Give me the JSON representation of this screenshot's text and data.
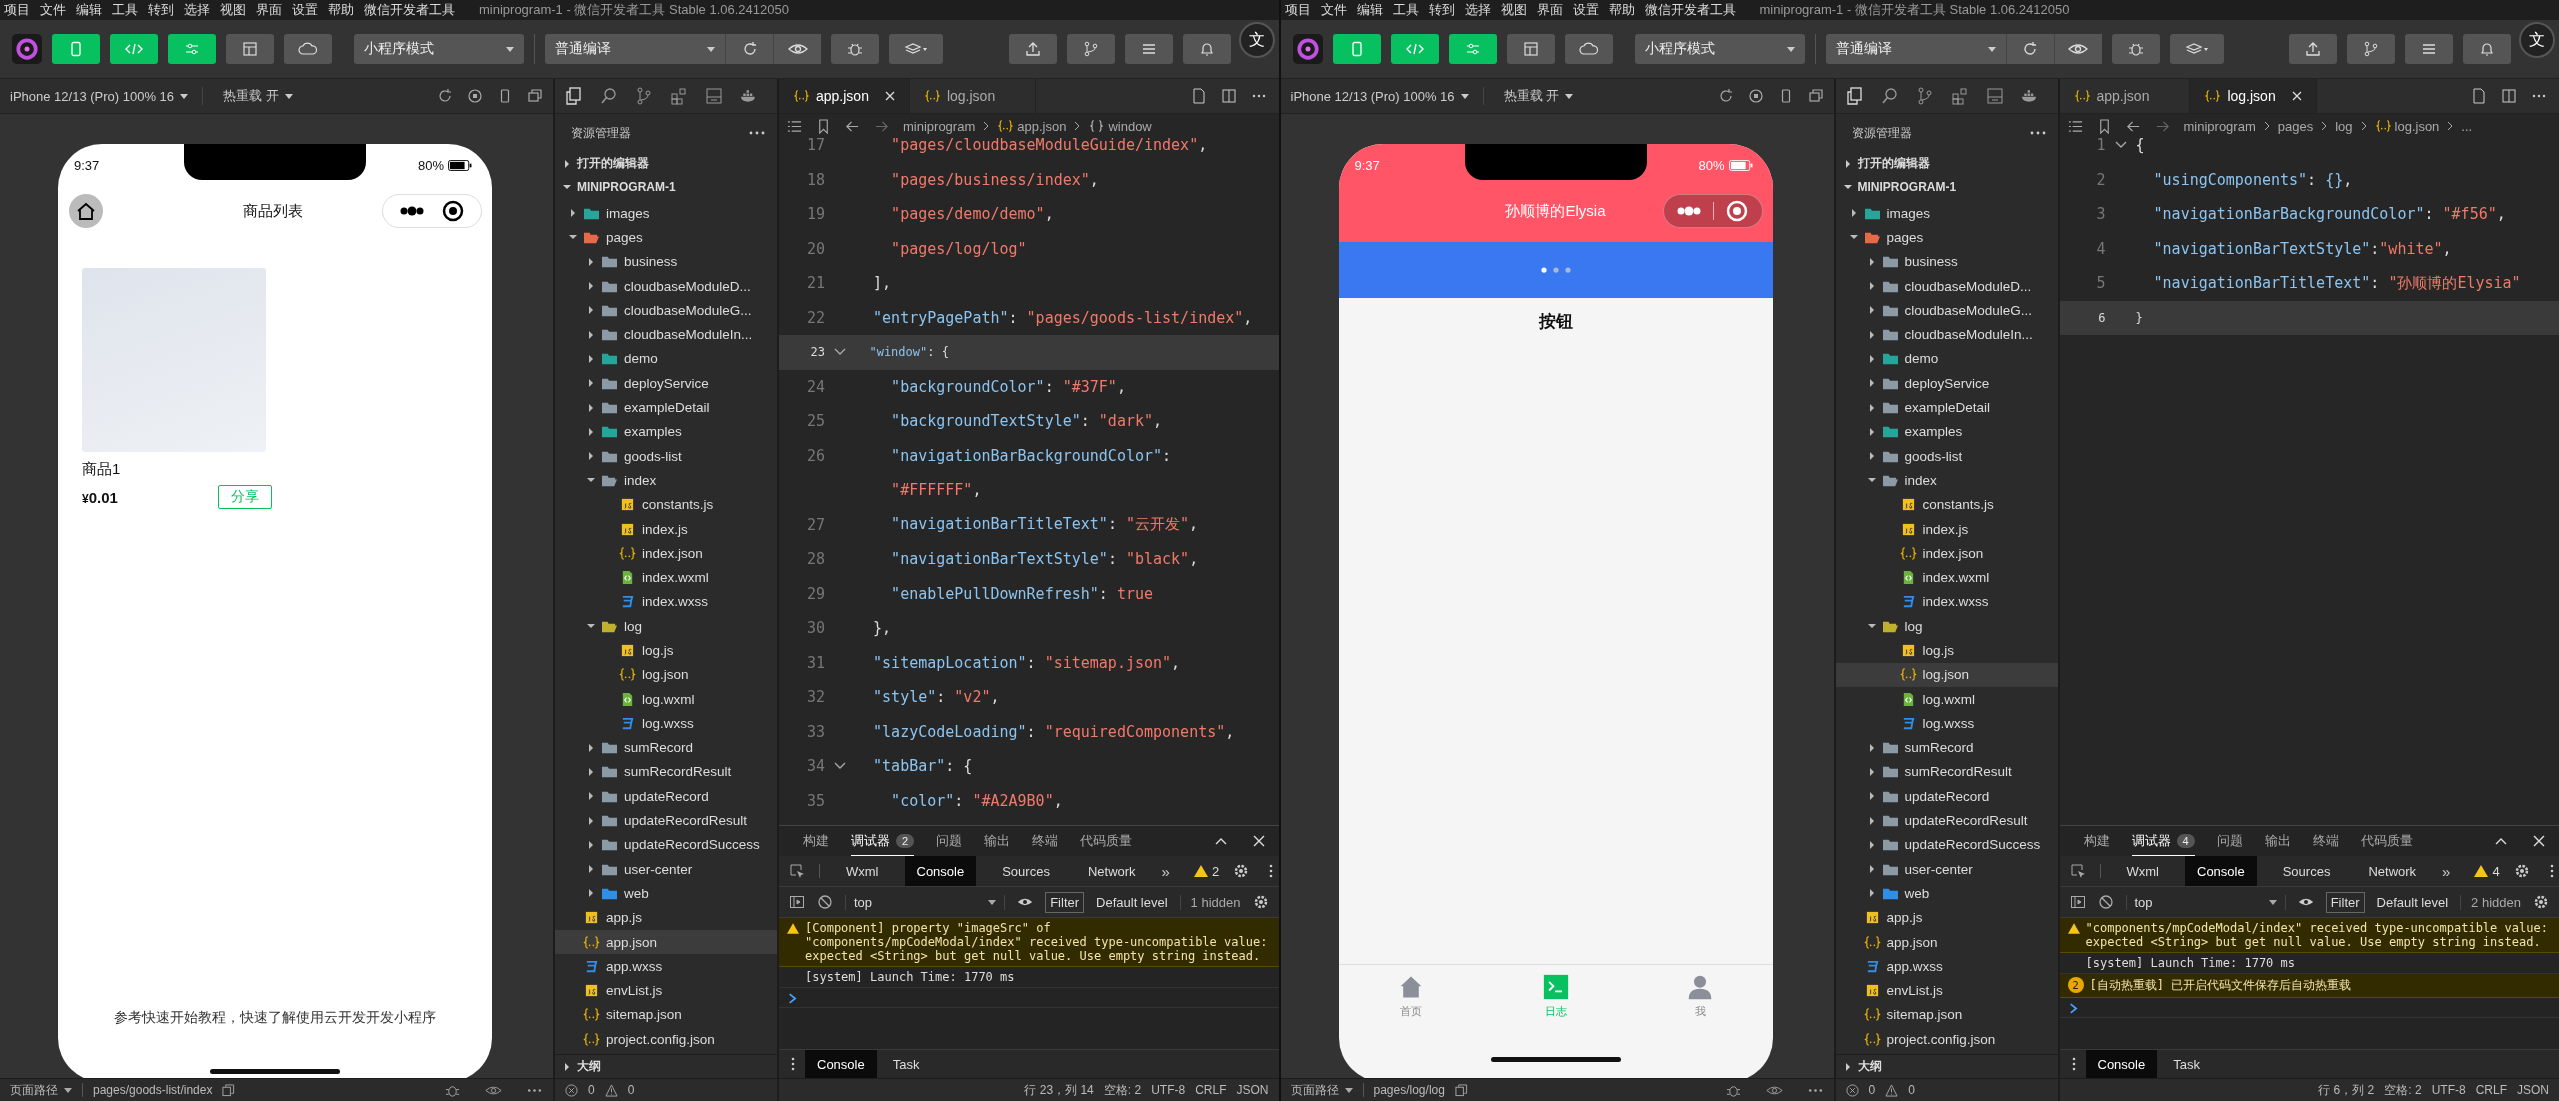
{
  "windows": [
    {
      "menu": [
        "项目",
        "文件",
        "编辑",
        "工具",
        "转到",
        "选择",
        "视图",
        "界面",
        "设置",
        "帮助",
        "微信开发者工具"
      ],
      "title": "miniprogram-1 - 微信开发者工具 Stable 1.06.2412050",
      "overlay_glyph": "文",
      "toolbar": {
        "mode": "小程序模式",
        "compile": "普通编译"
      },
      "device": "iPhone 12/13 (Pro) 100% 16",
      "hot_reload": "热重载 开",
      "simulator": {
        "kind": "goods",
        "time": "9:37",
        "battery": "80%",
        "title": "商品列表",
        "product": "商品1",
        "currency": "¥",
        "price": "0.01",
        "share": "分享",
        "footer": "参考快速开始教程，快速了解使用云开发开发小程序"
      },
      "explorer": {
        "title": "资源管理器",
        "open_editors": "打开的编辑器",
        "project": "MINIPROGRAM-1",
        "outline": "大纲",
        "tree": [
          {
            "label": "images",
            "kind": "folder",
            "color": "#26a69a",
            "expanded": false,
            "selected": false
          },
          {
            "label": "pages",
            "kind": "folder",
            "color": "#e8684a",
            "expanded": true,
            "selected": false,
            "children": [
              {
                "label": "business",
                "kind": "folder",
                "expanded": false,
                "selected": false
              },
              {
                "label": "cloudbaseModuleD...",
                "kind": "folder",
                "expanded": false,
                "selected": false
              },
              {
                "label": "cloudbaseModuleG...",
                "kind": "folder",
                "expanded": false,
                "selected": false
              },
              {
                "label": "cloudbaseModuleIn...",
                "kind": "folder",
                "expanded": false,
                "selected": false
              },
              {
                "label": "demo",
                "kind": "folder",
                "color": "#26a69a",
                "expanded": false,
                "selected": false
              },
              {
                "label": "deployService",
                "kind": "folder",
                "expanded": false,
                "selected": false
              },
              {
                "label": "exampleDetail",
                "kind": "folder",
                "expanded": false,
                "selected": false
              },
              {
                "label": "examples",
                "kind": "folder",
                "color": "#26a69a",
                "expanded": false,
                "selected": false
              },
              {
                "label": "goods-list",
                "kind": "folder",
                "expanded": false,
                "selected": false
              },
              {
                "label": "index",
                "kind": "folder",
                "expanded": true,
                "selected": false,
                "children": [
                  {
                    "label": "constants.js",
                    "kind": "js",
                    "selected": false
                  },
                  {
                    "label": "index.js",
                    "kind": "js",
                    "selected": false
                  },
                  {
                    "label": "index.json",
                    "kind": "json",
                    "selected": false
                  },
                  {
                    "label": "index.wxml",
                    "kind": "wxml",
                    "selected": false
                  },
                  {
                    "label": "index.wxss",
                    "kind": "wxss",
                    "selected": false
                  }
                ]
              },
              {
                "label": "log",
                "kind": "folder",
                "color": "#c0b030",
                "expanded": true,
                "selected": false,
                "children": [
                  {
                    "label": "log.js",
                    "kind": "js",
                    "selected": false
                  },
                  {
                    "label": "log.json",
                    "kind": "json",
                    "selected": false
                  },
                  {
                    "label": "log.wxml",
                    "kind": "wxml",
                    "selected": false
                  },
                  {
                    "label": "log.wxss",
                    "kind": "wxss",
                    "selected": false
                  }
                ]
              },
              {
                "label": "sumRecord",
                "kind": "folder",
                "expanded": false,
                "selected": false
              },
              {
                "label": "sumRecordResult",
                "kind": "folder",
                "expanded": false,
                "selected": false
              },
              {
                "label": "updateRecord",
                "kind": "folder",
                "expanded": false,
                "selected": false
              },
              {
                "label": "updateRecordResult",
                "kind": "folder",
                "expanded": false,
                "selected": false
              },
              {
                "label": "updateRecordSuccess",
                "kind": "folder",
                "expanded": false,
                "selected": false
              },
              {
                "label": "user-center",
                "kind": "folder",
                "expanded": false,
                "selected": false
              },
              {
                "label": "web",
                "kind": "folder",
                "color": "#2f8fe8",
                "expanded": false,
                "selected": false
              }
            ]
          },
          {
            "label": "app.js",
            "kind": "js",
            "selected": false
          },
          {
            "label": "app.json",
            "kind": "json",
            "selected": true
          },
          {
            "label": "app.wxss",
            "kind": "wxss",
            "selected": false
          },
          {
            "label": "envList.js",
            "kind": "js",
            "selected": false
          },
          {
            "label": "sitemap.json",
            "kind": "json",
            "selected": false
          },
          {
            "label": "project.config.json",
            "kind": "json",
            "selected": false
          }
        ]
      },
      "editor": {
        "tabs": [
          {
            "label": "app.json",
            "selected": true
          },
          {
            "label": "log.json",
            "selected": false
          }
        ],
        "breadcrumb": [
          {
            "kind": "folder",
            "text": "miniprogram"
          },
          {
            "kind": "json",
            "text": "app.json"
          },
          {
            "kind": "object",
            "text": "window"
          }
        ],
        "lines": [
          {
            "n": "17",
            "tokens": [
              {
                "kind": "str",
                "text": "    \"pages/cloudbaseModuleGuide/index\""
              },
              {
                "kind": "punc",
                "text": ","
              }
            ]
          },
          {
            "n": "18",
            "tokens": [
              {
                "kind": "str",
                "text": "    \"pages/business/index\""
              },
              {
                "kind": "punc",
                "text": ","
              }
            ]
          },
          {
            "n": "19",
            "tokens": [
              {
                "kind": "str",
                "text": "    \"pages/demo/demo\""
              },
              {
                "kind": "punc",
                "text": ","
              }
            ]
          },
          {
            "n": "20",
            "tokens": [
              {
                "kind": "str",
                "text": "    \"pages/log/log\""
              }
            ]
          },
          {
            "n": "21",
            "tokens": [
              {
                "kind": "punc",
                "text": "  ],"
              }
            ]
          },
          {
            "n": "22",
            "tokens": [
              {
                "kind": "key",
                "text": "  \"entryPagePath\""
              },
              {
                "kind": "punc",
                "text": ": "
              },
              {
                "kind": "str",
                "text": "\"pages/goods-list/index\""
              },
              {
                "kind": "punc",
                "text": ","
              }
            ]
          },
          {
            "n": "23",
            "current": true,
            "fold": true,
            "tokens": [
              {
                "kind": "key",
                "text": "  \"window\""
              },
              {
                "kind": "punc",
                "text": ": {"
              }
            ]
          },
          {
            "n": "24",
            "tokens": [
              {
                "kind": "key",
                "text": "    \"backgroundColor\""
              },
              {
                "kind": "punc",
                "text": ": "
              },
              {
                "kind": "str",
                "text": "\"#37F\""
              },
              {
                "kind": "punc",
                "text": ","
              }
            ]
          },
          {
            "n": "25",
            "tokens": [
              {
                "kind": "key",
                "text": "    \"backgroundTextStyle\""
              },
              {
                "kind": "punc",
                "text": ": "
              },
              {
                "kind": "str",
                "text": "\"dark\""
              },
              {
                "kind": "punc",
                "text": ","
              }
            ]
          },
          {
            "n": "26",
            "tokens": [
              {
                "kind": "key",
                "text": "    \"navigationBarBackgroundColor\""
              },
              {
                "kind": "punc",
                "text": ":"
              }
            ]
          },
          {
            "tokens": [
              {
                "kind": "str",
                "text": "    \"#FFFFFF\""
              },
              {
                "kind": "punc",
                "text": ","
              }
            ]
          },
          {
            "n": "27",
            "tokens": [
              {
                "kind": "key",
                "text": "    \"navigationBarTitleText\""
              },
              {
                "kind": "punc",
                "text": ": "
              },
              {
                "kind": "str",
                "text": "\"云开发\""
              },
              {
                "kind": "punc",
                "text": ","
              }
            ]
          },
          {
            "n": "28",
            "tokens": [
              {
                "kind": "key",
                "text": "    \"navigationBarTextStyle\""
              },
              {
                "kind": "punc",
                "text": ": "
              },
              {
                "kind": "str",
                "text": "\"black\""
              },
              {
                "kind": "punc",
                "text": ","
              }
            ]
          },
          {
            "n": "29",
            "tokens": [
              {
                "kind": "key",
                "text": "    \"enablePullDownRefresh\""
              },
              {
                "kind": "punc",
                "text": ": "
              },
              {
                "kind": "str",
                "text": "true"
              }
            ]
          },
          {
            "n": "30",
            "tokens": [
              {
                "kind": "punc",
                "text": "  },"
              }
            ]
          },
          {
            "n": "31",
            "tokens": [
              {
                "kind": "key",
                "text": "  \"sitemapLocation\""
              },
              {
                "kind": "punc",
                "text": ": "
              },
              {
                "kind": "str",
                "text": "\"sitemap.json\""
              },
              {
                "kind": "punc",
                "text": ","
              }
            ]
          },
          {
            "n": "32",
            "tokens": [
              {
                "kind": "key",
                "text": "  \"style\""
              },
              {
                "kind": "punc",
                "text": ": "
              },
              {
                "kind": "str",
                "text": "\"v2\""
              },
              {
                "kind": "punc",
                "text": ","
              }
            ]
          },
          {
            "n": "33",
            "tokens": [
              {
                "kind": "key",
                "text": "  \"lazyCodeLoading\""
              },
              {
                "kind": "punc",
                "text": ": "
              },
              {
                "kind": "str",
                "text": "\"requiredComponents\""
              },
              {
                "kind": "punc",
                "text": ","
              }
            ]
          },
          {
            "n": "34",
            "fold": true,
            "tokens": [
              {
                "kind": "key",
                "text": "  \"tabBar\""
              },
              {
                "kind": "punc",
                "text": ": {"
              }
            ]
          },
          {
            "n": "35",
            "tokens": [
              {
                "kind": "key",
                "text": "    \"color\""
              },
              {
                "kind": "punc",
                "text": ": "
              },
              {
                "kind": "str",
                "text": "\"#A2A9B0\""
              },
              {
                "kind": "punc",
                "text": ","
              }
            ]
          }
        ]
      },
      "debugger": {
        "tabs": [
          {
            "label": "构建",
            "selected": false
          },
          {
            "label": "调试器",
            "selected": true,
            "badge": "2"
          },
          {
            "label": "问题",
            "selected": false
          },
          {
            "label": "输出",
            "selected": false
          },
          {
            "label": "终端",
            "selected": false
          },
          {
            "label": "代码质量",
            "selected": false
          }
        ],
        "devtabs": [
          {
            "label": "Wxml",
            "selected": false
          },
          {
            "label": "Console",
            "selected": true
          },
          {
            "label": "Sources",
            "selected": false
          },
          {
            "label": "Network",
            "selected": false
          }
        ],
        "more": "»",
        "warnings": "2",
        "context": "top",
        "filter": "Filter",
        "level": "Default level",
        "hidden": "1 hidden",
        "messages": [
          {
            "kind": "warning",
            "text": "[Component] property \"imageSrc\" of \"components/mpCodeModal/index\" received type-uncompatible value: expected <String> but get null value. Use empty string instead."
          },
          {
            "kind": "log",
            "text": "[system] Launch Time: 1770 ms"
          }
        ],
        "bottom_tabs": [
          {
            "label": "Console",
            "selected": true
          },
          {
            "label": "Task",
            "selected": false
          }
        ]
      },
      "status": {
        "page_path": "页面路径",
        "path": "pages/goods-list/index",
        "errors": "0",
        "warnings": "0",
        "cursor": "行 23，列 14",
        "spaces": "空格: 2",
        "encoding": "UTF-8",
        "eol": "CRLF",
        "language": "JSON"
      }
    },
    {
      "menu": [
        "项目",
        "文件",
        "编辑",
        "工具",
        "转到",
        "选择",
        "视图",
        "界面",
        "设置",
        "帮助",
        "微信开发者工具"
      ],
      "title": "miniprogram-1 - 微信开发者工具 Stable 1.06.2412050",
      "overlay_glyph": "文",
      "toolbar": {
        "mode": "小程序模式",
        "compile": "普通编译"
      },
      "device": "iPhone 12/13 (Pro) 100% 16",
      "hot_reload": "热重载 开",
      "simulator": {
        "kind": "log",
        "time": "9:37",
        "battery": "80%",
        "title": "孙顺博的Elysia",
        "button": "按钮",
        "tabs": [
          {
            "label": "首页",
            "selected": false
          },
          {
            "label": "日志",
            "selected": true
          },
          {
            "label": "我",
            "selected": false
          }
        ]
      },
      "explorer": {
        "title": "资源管理器",
        "open_editors": "打开的编辑器",
        "project": "MINIPROGRAM-1",
        "outline": "大纲",
        "tree": [
          {
            "label": "images",
            "kind": "folder",
            "color": "#26a69a",
            "expanded": false,
            "selected": false
          },
          {
            "label": "pages",
            "kind": "folder",
            "color": "#e8684a",
            "expanded": true,
            "selected": false,
            "children": [
              {
                "label": "business",
                "kind": "folder",
                "expanded": false,
                "selected": false
              },
              {
                "label": "cloudbaseModuleD...",
                "kind": "folder",
                "expanded": false,
                "selected": false
              },
              {
                "label": "cloudbaseModuleG...",
                "kind": "folder",
                "expanded": false,
                "selected": false
              },
              {
                "label": "cloudbaseModuleIn...",
                "kind": "folder",
                "expanded": false,
                "selected": false
              },
              {
                "label": "demo",
                "kind": "folder",
                "color": "#26a69a",
                "expanded": false,
                "selected": false
              },
              {
                "label": "deployService",
                "kind": "folder",
                "expanded": false,
                "selected": false
              },
              {
                "label": "exampleDetail",
                "kind": "folder",
                "expanded": false,
                "selected": false
              },
              {
                "label": "examples",
                "kind": "folder",
                "color": "#26a69a",
                "expanded": false,
                "selected": false
              },
              {
                "label": "goods-list",
                "kind": "folder",
                "expanded": false,
                "selected": false
              },
              {
                "label": "index",
                "kind": "folder",
                "expanded": true,
                "selected": false,
                "children": [
                  {
                    "label": "constants.js",
                    "kind": "js",
                    "selected": false
                  },
                  {
                    "label": "index.js",
                    "kind": "js",
                    "selected": false
                  },
                  {
                    "label": "index.json",
                    "kind": "json",
                    "selected": false
                  },
                  {
                    "label": "index.wxml",
                    "kind": "wxml",
                    "selected": false
                  },
                  {
                    "label": "index.wxss",
                    "kind": "wxss",
                    "selected": false
                  }
                ]
              },
              {
                "label": "log",
                "kind": "folder",
                "color": "#c0b030",
                "expanded": true,
                "selected": false,
                "children": [
                  {
                    "label": "log.js",
                    "kind": "js",
                    "selected": false
                  },
                  {
                    "label": "log.json",
                    "kind": "json",
                    "selected": true
                  },
                  {
                    "label": "log.wxml",
                    "kind": "wxml",
                    "selected": false
                  },
                  {
                    "label": "log.wxss",
                    "kind": "wxss",
                    "selected": false
                  }
                ]
              },
              {
                "label": "sumRecord",
                "kind": "folder",
                "expanded": false,
                "selected": false
              },
              {
                "label": "sumRecordResult",
                "kind": "folder",
                "expanded": false,
                "selected": false
              },
              {
                "label": "updateRecord",
                "kind": "folder",
                "expanded": false,
                "selected": false
              },
              {
                "label": "updateRecordResult",
                "kind": "folder",
                "expanded": false,
                "selected": false
              },
              {
                "label": "updateRecordSuccess",
                "kind": "folder",
                "expanded": false,
                "selected": false
              },
              {
                "label": "user-center",
                "kind": "folder",
                "expanded": false,
                "selected": false
              },
              {
                "label": "web",
                "kind": "folder",
                "color": "#2f8fe8",
                "expanded": false,
                "selected": false
              }
            ]
          },
          {
            "label": "app.js",
            "kind": "js",
            "selected": false
          },
          {
            "label": "app.json",
            "kind": "json",
            "selected": false
          },
          {
            "label": "app.wxss",
            "kind": "wxss",
            "selected": false
          },
          {
            "label": "envList.js",
            "kind": "js",
            "selected": false
          },
          {
            "label": "sitemap.json",
            "kind": "json",
            "selected": false
          },
          {
            "label": "project.config.json",
            "kind": "json",
            "selected": false
          }
        ]
      },
      "editor": {
        "tabs": [
          {
            "label": "app.json",
            "selected": false
          },
          {
            "label": "log.json",
            "selected": true
          }
        ],
        "breadcrumb": [
          {
            "kind": "folder",
            "text": "miniprogram"
          },
          {
            "kind": "folder",
            "text": "pages"
          },
          {
            "kind": "folder",
            "text": "log"
          },
          {
            "kind": "json",
            "text": "log.json"
          },
          {
            "kind": "folder",
            "text": "..."
          }
        ],
        "lines": [
          {
            "n": "1",
            "fold": true,
            "tokens": [
              {
                "kind": "punc",
                "text": "{"
              }
            ]
          },
          {
            "n": "2",
            "tokens": [
              {
                "kind": "key",
                "text": "  \"usingComponents\""
              },
              {
                "kind": "punc",
                "text": ": "
              },
              {
                "kind": "key",
                "text": "{}"
              },
              {
                "kind": "punc",
                "text": ","
              }
            ]
          },
          {
            "n": "3",
            "tokens": [
              {
                "kind": "key",
                "text": "  \"navigationBarBackgroundColor\""
              },
              {
                "kind": "punc",
                "text": ": "
              },
              {
                "kind": "str",
                "text": "\"#f56\""
              },
              {
                "kind": "punc",
                "text": ","
              }
            ]
          },
          {
            "n": "4",
            "tokens": [
              {
                "kind": "key",
                "text": "  \"navigationBarTextStyle\""
              },
              {
                "kind": "punc",
                "text": ":"
              },
              {
                "kind": "str",
                "text": "\"white\""
              },
              {
                "kind": "punc",
                "text": ","
              }
            ]
          },
          {
            "n": "5",
            "tokens": [
              {
                "kind": "key",
                "text": "  \"navigationBarTitleText\""
              },
              {
                "kind": "punc",
                "text": ": "
              },
              {
                "kind": "str",
                "text": "\"孙顺博的Elysia\""
              }
            ]
          },
          {
            "n": "6",
            "current": true,
            "tokens": [
              {
                "kind": "punc",
                "text": "}"
              }
            ]
          }
        ]
      },
      "debugger": {
        "tabs": [
          {
            "label": "构建",
            "selected": false
          },
          {
            "label": "调试器",
            "selected": true,
            "badge": "4"
          },
          {
            "label": "问题",
            "selected": false
          },
          {
            "label": "输出",
            "selected": false
          },
          {
            "label": "终端",
            "selected": false
          },
          {
            "label": "代码质量",
            "selected": false
          }
        ],
        "devtabs": [
          {
            "label": "Wxml",
            "selected": false
          },
          {
            "label": "Console",
            "selected": true
          },
          {
            "label": "Sources",
            "selected": false
          },
          {
            "label": "Network",
            "selected": false
          }
        ],
        "more": "»",
        "warnings": "4",
        "context": "top",
        "filter": "Filter",
        "level": "Default level",
        "hidden": "2 hidden",
        "messages": [
          {
            "kind": "warning",
            "text": "\"components/mpCodeModal/index\" received type-uncompatible value: expected <String> but get null value. Use empty string instead."
          },
          {
            "kind": "log",
            "text": "[system] Launch Time: 1770 ms"
          },
          {
            "kind": "info",
            "badge": "2",
            "text": "[自动热重载] 已开启代码文件保存后自动热重载"
          }
        ],
        "bottom_tabs": [
          {
            "label": "Console",
            "selected": true
          },
          {
            "label": "Task",
            "selected": false
          }
        ]
      },
      "status": {
        "page_path": "页面路径",
        "path": "pages/log/log",
        "errors": "0",
        "warnings": "0",
        "cursor": "行 6，列 2",
        "spaces": "空格: 2",
        "encoding": "UTF-8",
        "eol": "CRLF",
        "language": "JSON"
      }
    }
  ]
}
